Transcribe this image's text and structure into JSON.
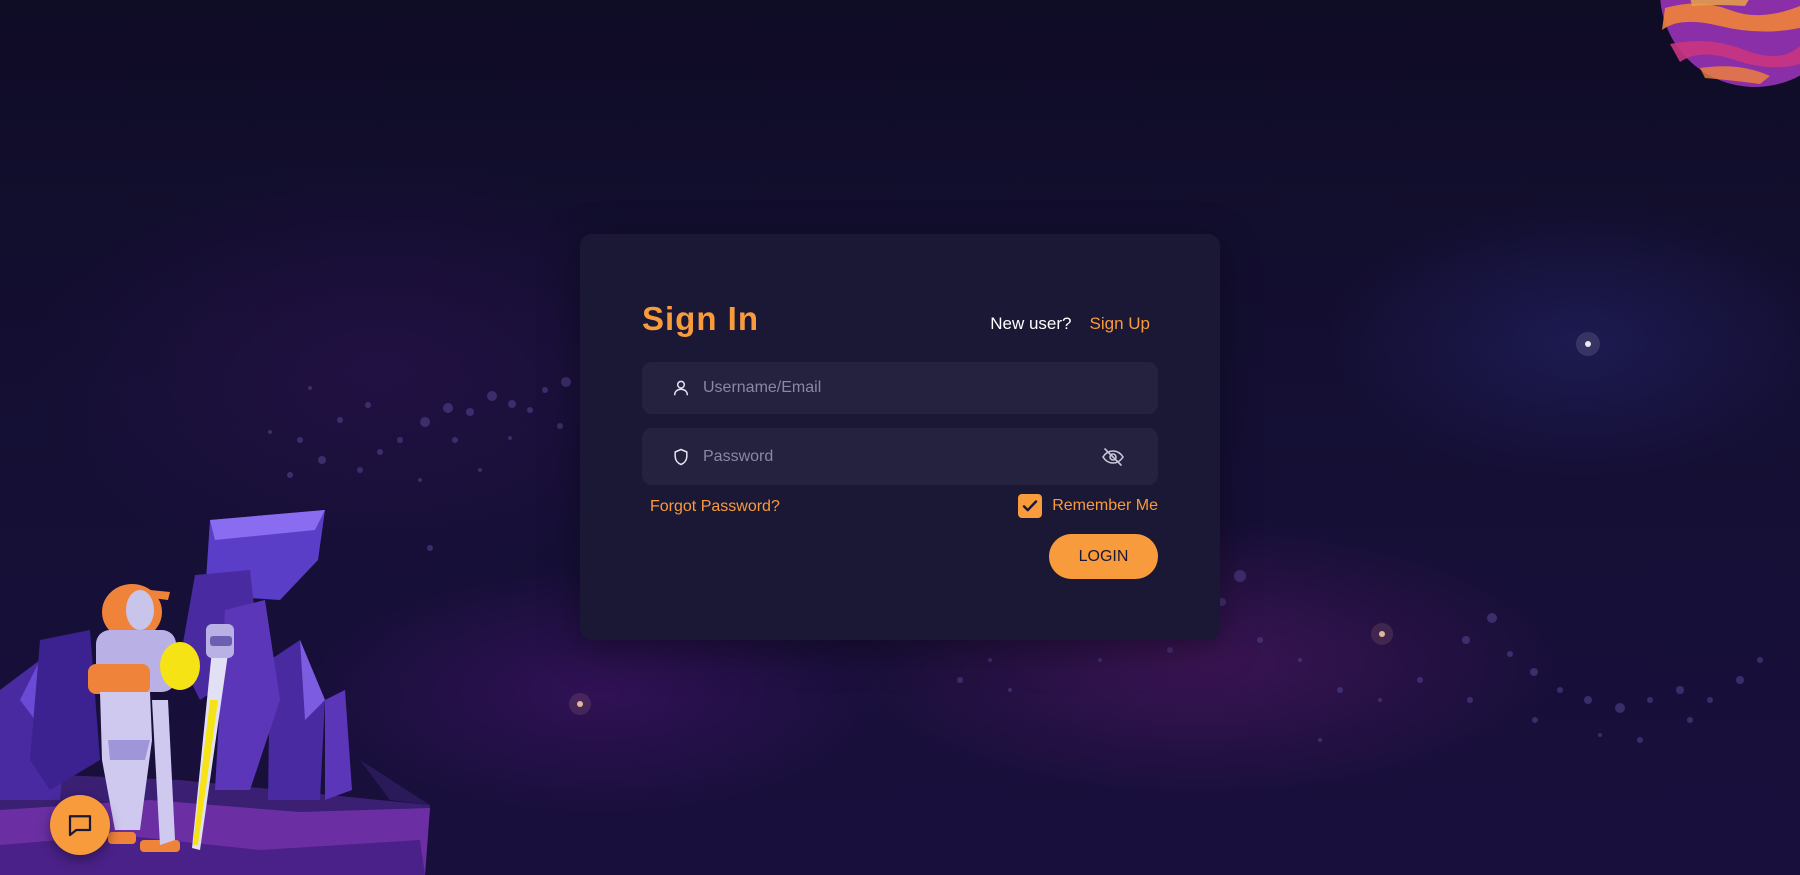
{
  "theme": {
    "accent": "#f89b3d",
    "card_bg": "#1b1835",
    "field_bg": "#25223f",
    "page_bg": "#140f33"
  },
  "login_card": {
    "title": "Sign In",
    "new_user_text": "New user?",
    "signup_link": "Sign Up",
    "username": {
      "placeholder": "Username/Email",
      "value": "",
      "icon": "user-icon"
    },
    "password": {
      "placeholder": "Password",
      "value": "",
      "icon": "shield-icon",
      "toggle_icon": "eye-off-icon"
    },
    "forgot_password": "Forgot Password?",
    "remember_me": {
      "label": "Remember Me",
      "checked": true
    },
    "login_button": "LOGIN"
  },
  "chat_widget": {
    "icon": "chat-bubble-icon"
  },
  "background": {
    "illustration": "astronaut-on-alien-planet",
    "planet": "planet-illustration"
  }
}
